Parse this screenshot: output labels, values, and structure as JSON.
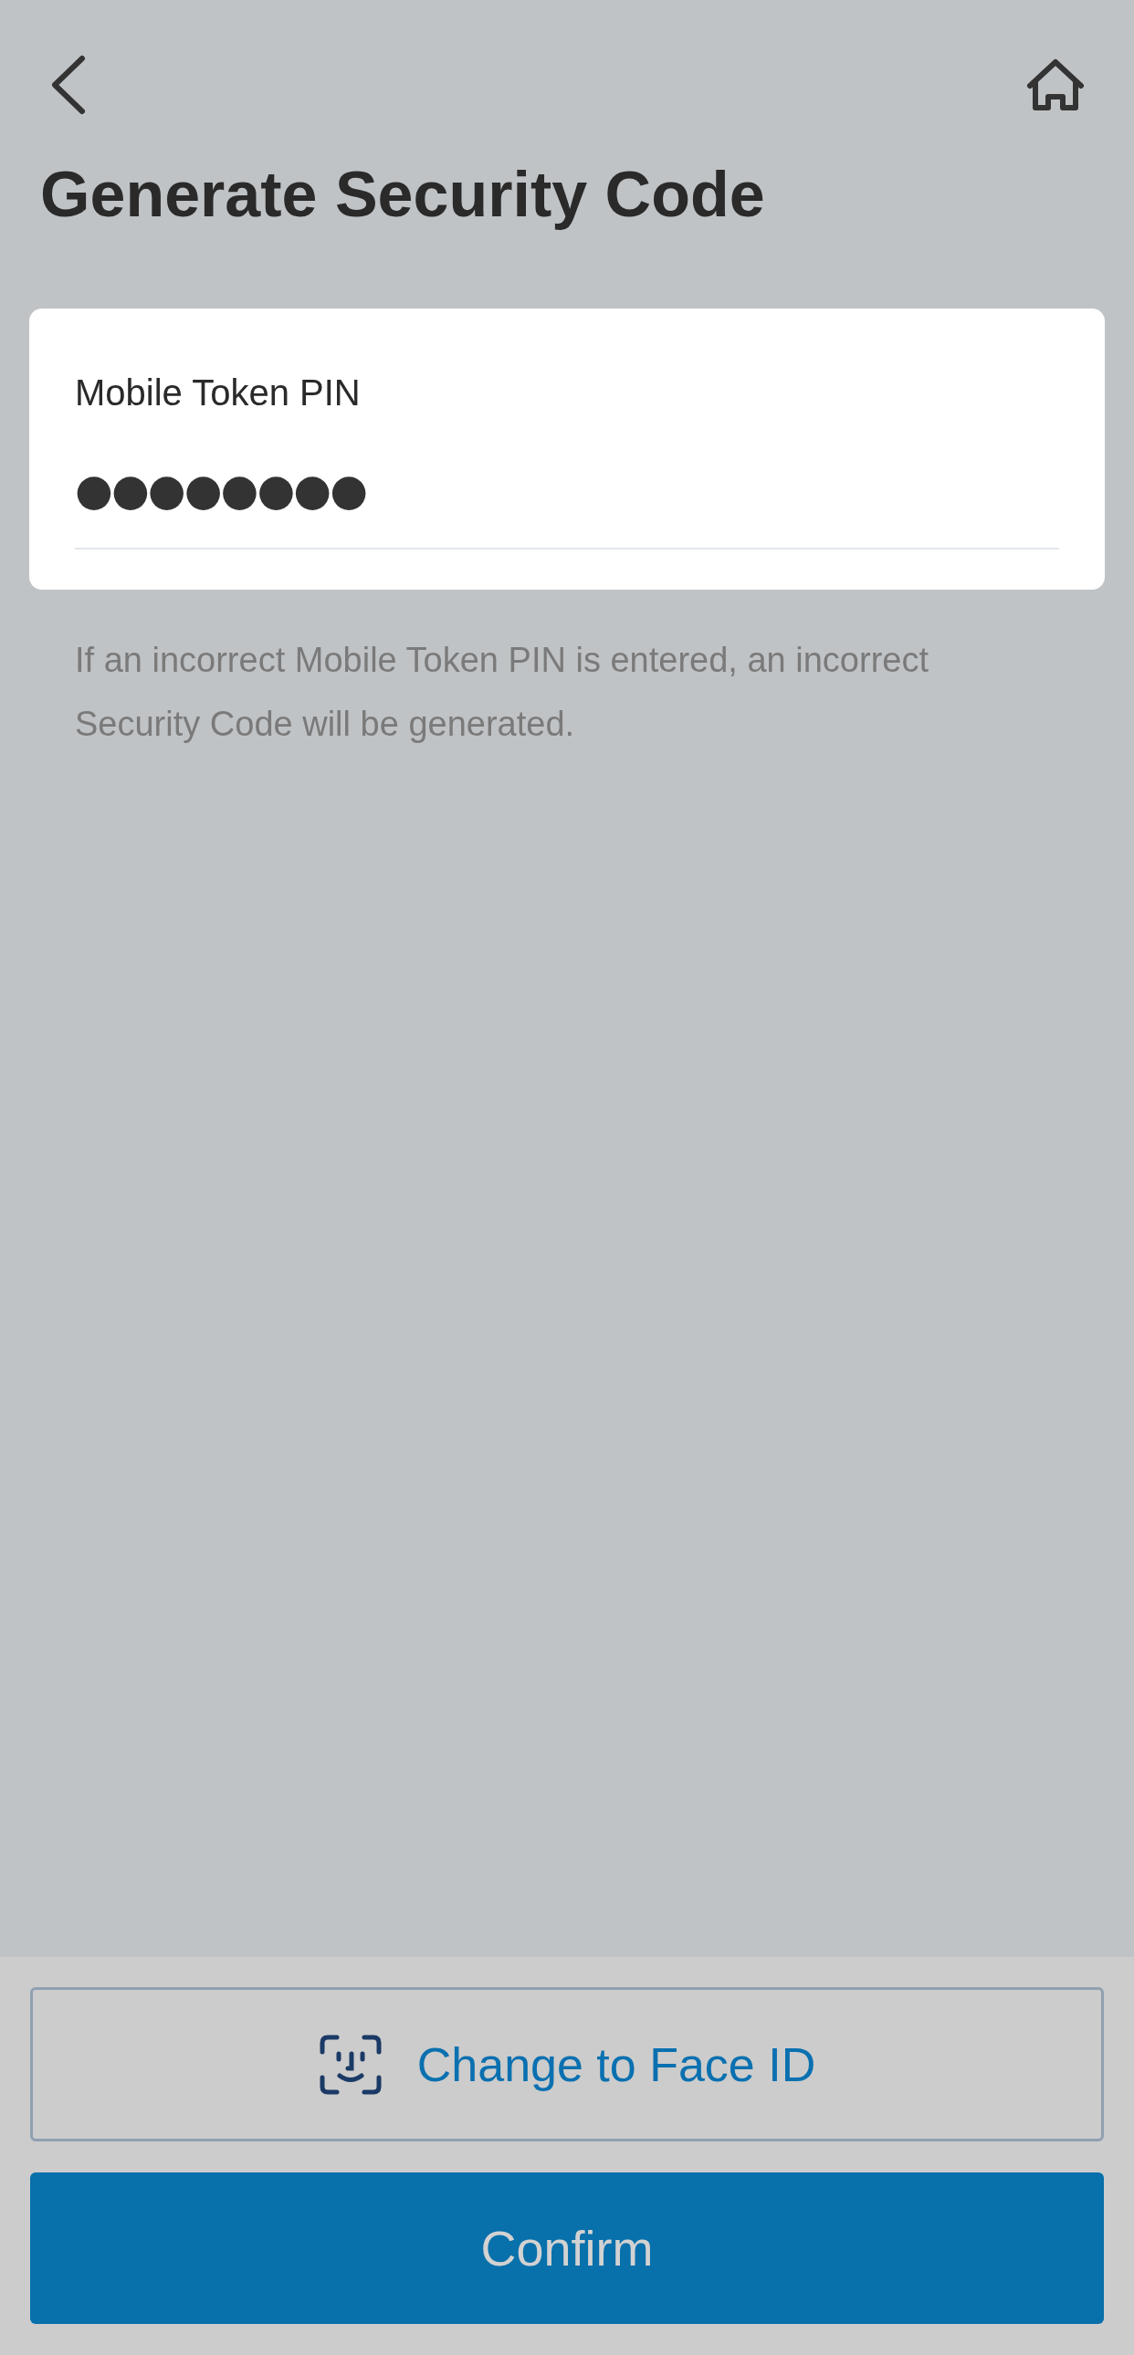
{
  "header": {
    "title": "Generate Security Code"
  },
  "pin_field": {
    "label": "Mobile Token PIN",
    "value": "●●●●●●●●"
  },
  "hint": "If an incorrect Mobile Token PIN is entered, an incorrect Security Code will be generated.",
  "buttons": [
    {
      "kind": "outline",
      "label": "Change to Face ID"
    },
    {
      "kind": "primary",
      "label": "Confirm"
    }
  ]
}
